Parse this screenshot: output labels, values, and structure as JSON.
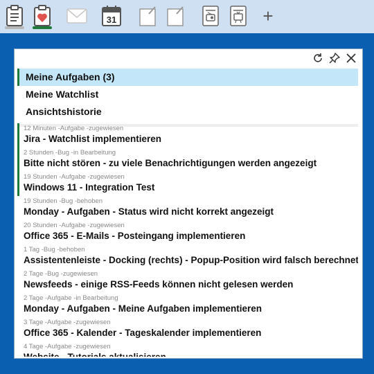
{
  "toolbar": {
    "calendar_day": "31",
    "add_label": "+"
  },
  "colors": {
    "accent_green": "#1e7a3a",
    "selection": "#c3e7f8",
    "background_blue": "#0a5fb0",
    "heart_red": "#e0524d"
  },
  "panel": {
    "views": [
      {
        "label": "Meine Aufgaben  (3)"
      },
      {
        "label": "Meine Watchlist"
      },
      {
        "label": "Ansichtshistorie"
      }
    ],
    "items": [
      {
        "meta": "12 Minuten -Aufgabe -zugewiesen",
        "title": "Jira - Watchlist implementieren",
        "unread": true
      },
      {
        "meta": "2 Stunden -Bug -in Bearbeitung",
        "title": "Bitte nicht stören - zu viele Benachrichtigungen werden angezeigt",
        "unread": true
      },
      {
        "meta": "19 Stunden -Aufgabe -zugewiesen",
        "title": "Windows 11 - Integration Test",
        "unread": true
      },
      {
        "meta": "19 Stunden -Bug -behoben",
        "title": "Monday - Aufgaben - Status wird nicht korrekt angezeigt",
        "unread": false
      },
      {
        "meta": "20 Stunden -Aufgabe -zugewiesen",
        "title": "Office 365 - E-Mails - Posteingang implementieren",
        "unread": false
      },
      {
        "meta": "1 Tag -Bug -behoben",
        "title": "Assistentenleiste - Docking (rechts) - Popup-Position wird falsch berechnet",
        "unread": false
      },
      {
        "meta": "2 Tage -Bug -zugewiesen",
        "title": "Newsfeeds - einige RSS-Feeds können nicht gelesen werden",
        "unread": false
      },
      {
        "meta": "2 Tage -Aufgabe -in Bearbeitung",
        "title": "Monday - Aufgaben - Meine Aufgaben implementieren",
        "unread": false
      },
      {
        "meta": "3 Tage -Aufgabe -zugewiesen",
        "title": "Office 365 - Kalender - Tageskalender implementieren",
        "unread": false
      },
      {
        "meta": "4 Tage -Aufgabe -zugewiesen",
        "title": "Website - Tutorials aktualisieren",
        "unread": false
      }
    ]
  }
}
